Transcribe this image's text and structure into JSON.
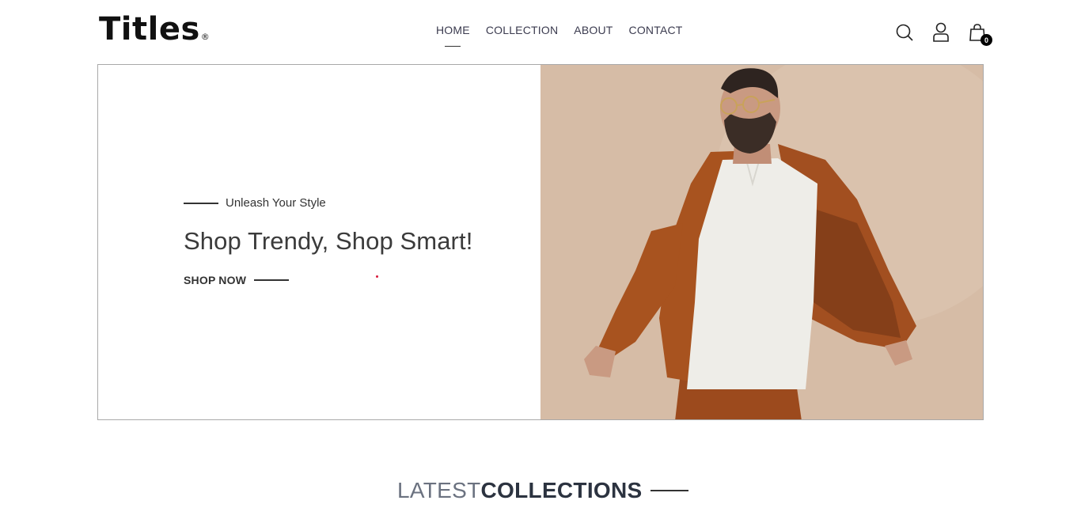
{
  "brand": {
    "name": "Titles",
    "reg_mark": "®"
  },
  "nav": {
    "items": [
      {
        "label": "HOME",
        "active": true
      },
      {
        "label": "COLLECTION",
        "active": false
      },
      {
        "label": "ABOUT",
        "active": false
      },
      {
        "label": "CONTACT",
        "active": false
      }
    ]
  },
  "header_icons": {
    "search": "search-icon",
    "account": "user-icon",
    "cart": "shopping-bag-icon",
    "cart_count": "0"
  },
  "hero": {
    "tagline": "Unleash Your Style",
    "headline": "Shop Trendy, Shop Smart!",
    "cta_label": "SHOP NOW",
    "image_description_icon": "model-photo"
  },
  "section": {
    "title_light": "LATEST",
    "title_bold": "COLLECTIONS"
  },
  "colors": {
    "text_dark": "#333333",
    "nav_text": "#3b3b4f",
    "hero_bg": "#d4b8a1",
    "jacket": "#a8531f",
    "badge": "#000000",
    "dot": "#d81b3c"
  }
}
